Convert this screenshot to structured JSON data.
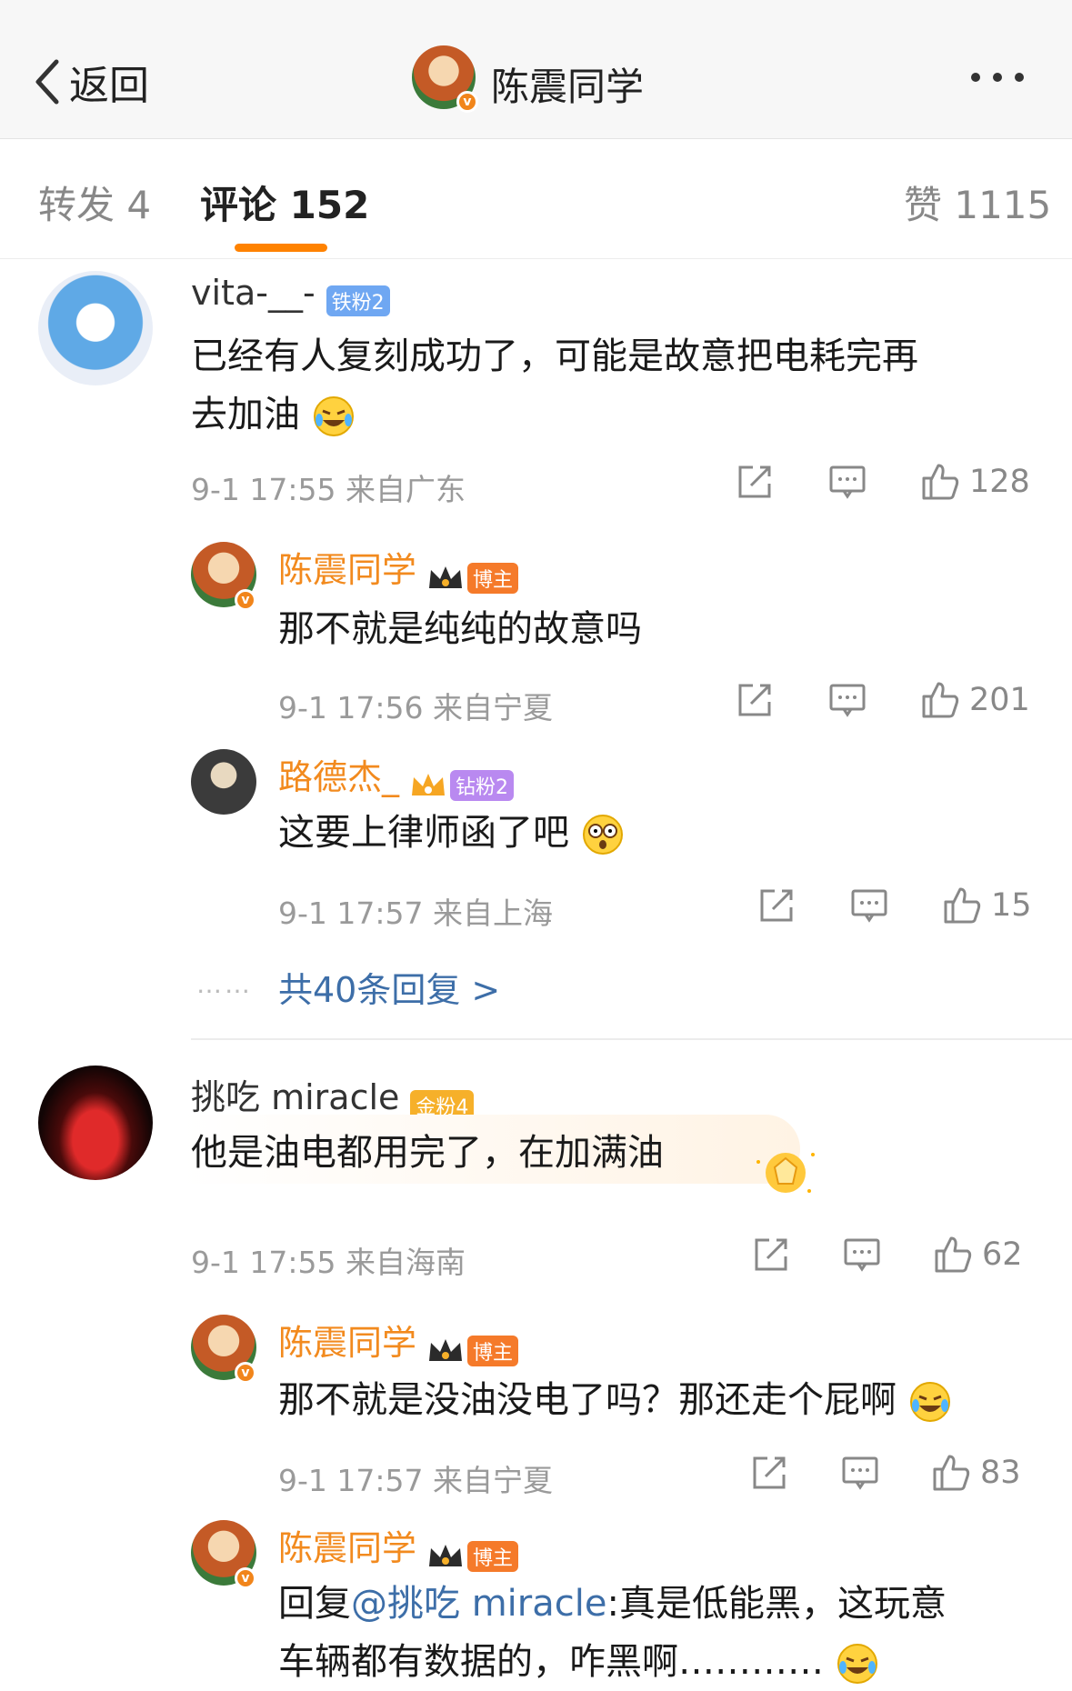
{
  "header": {
    "back_label": "返回",
    "title": "陈震同学"
  },
  "tabs": {
    "repost": "转发 4",
    "comment": "评论 152",
    "like": "赞 1115"
  },
  "comments": [
    {
      "user": "vita-__-",
      "badge": "铁粉2",
      "text1": "已经有人复刻成功了，可能是故意把电耗完再",
      "text2": "去加油",
      "meta": "9-1 17:55  来自广东",
      "likes": "128",
      "replies": [
        {
          "user": "陈震同学",
          "badge": "博主",
          "text": "那不就是纯纯的故意吗",
          "meta": "9-1 17:56  来自宁夏",
          "likes": "201"
        },
        {
          "user": "路德杰_",
          "badge": "钻粉2",
          "text": "这要上律师函了吧",
          "meta": "9-1 17:57  来自上海",
          "likes": "15"
        }
      ],
      "more_replies": "共40条回复 >"
    },
    {
      "user": "挑吃 miracle",
      "badge": "金粉4",
      "text": "他是油电都用完了，在加满油",
      "meta": "9-1 17:55  来自海南",
      "likes": "62",
      "replies": [
        {
          "user": "陈震同学",
          "badge": "博主",
          "text": "那不就是没油没电了吗？那还走个屁啊",
          "meta": "9-1 17:57  来自宁夏",
          "likes": "83"
        },
        {
          "user": "陈震同学",
          "badge": "博主",
          "reply_prefix": "回复",
          "mention": "@挑吃 miracle",
          "text1": ":真是低能黑，这玩意",
          "text2": "车辆都有数据的，咋黑啊…………"
        }
      ]
    }
  ],
  "colors": {
    "accent": "#ff8200",
    "link": "#3d6ea8",
    "author": "#f28a1e"
  }
}
